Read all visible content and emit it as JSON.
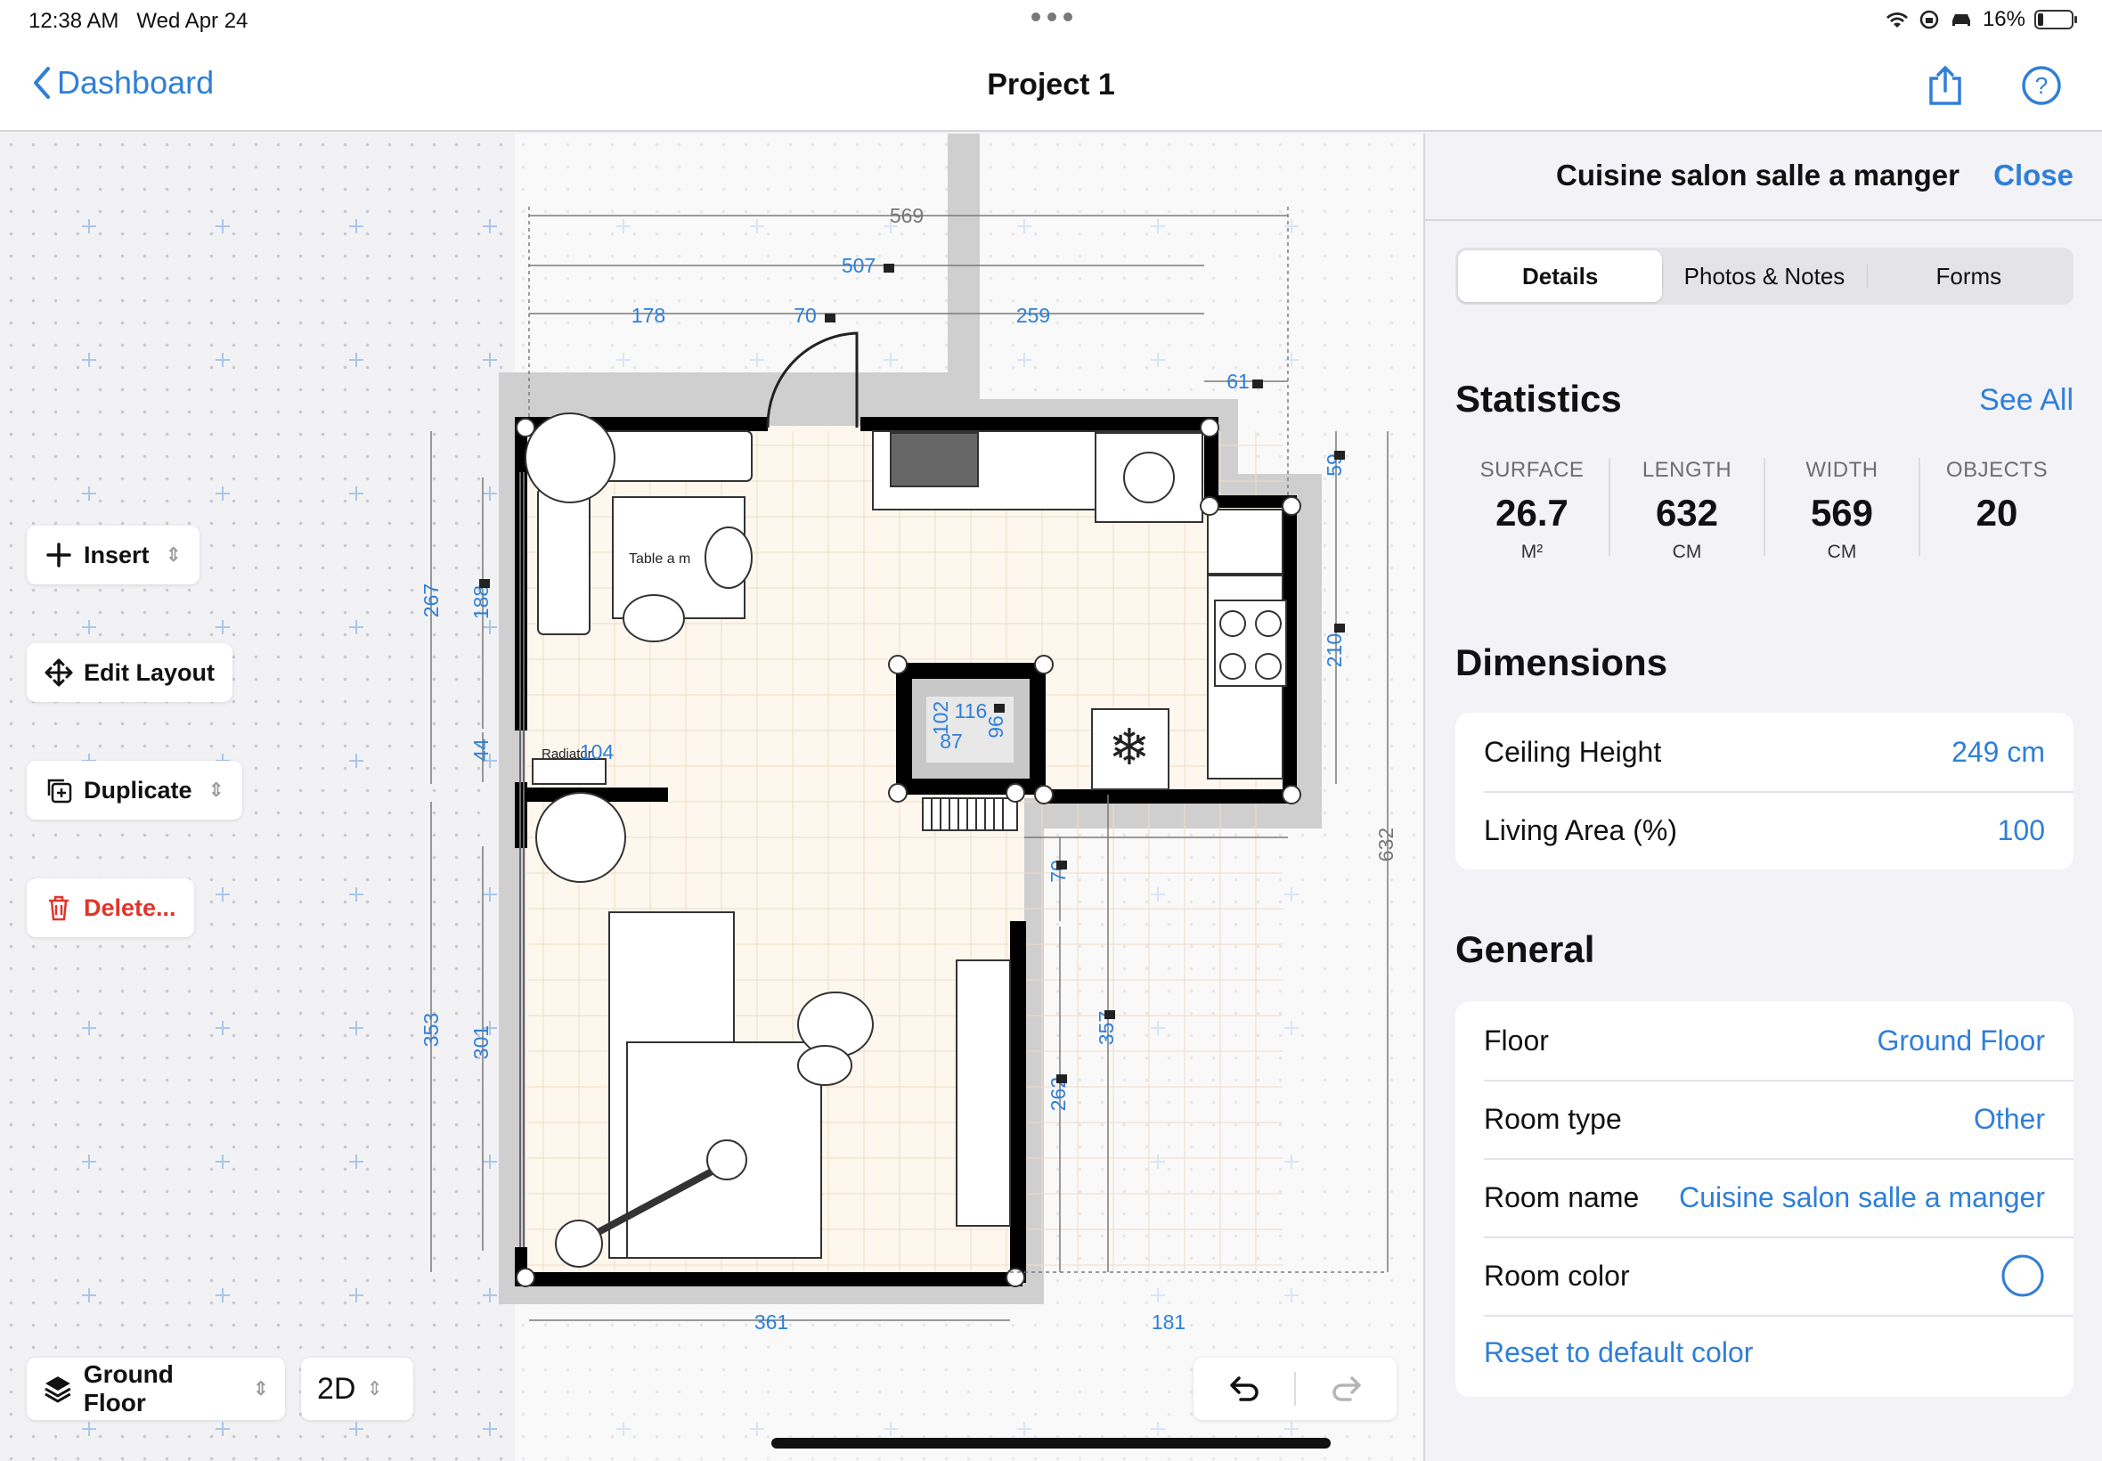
{
  "status_bar": {
    "time": "12:38 AM",
    "date": "Wed Apr 24",
    "battery": "16%",
    "battery_level": 0.16
  },
  "nav": {
    "back_label": "Dashboard",
    "title": "Project 1",
    "share_icon": "share-icon",
    "help_icon": "help-icon"
  },
  "toolbar": {
    "insert_label": "Insert",
    "edit_layout_label": "Edit Layout",
    "duplicate_label": "Duplicate",
    "delete_label": "Delete..."
  },
  "bottom": {
    "floor_label": "Ground Floor",
    "view_mode": "2D"
  },
  "plan": {
    "dims": {
      "top_total": "569",
      "top_inner": "507",
      "seg_left": "178",
      "seg_door": "70",
      "seg_right": "259",
      "step": "61",
      "right_total": "632",
      "right_upper": "59",
      "right_mid": "210",
      "kitchen_bottom": "181",
      "door2": "70",
      "right_lower": "262",
      "right_lower_total": "357",
      "bottom": "361",
      "left_upper_total": "267",
      "left_upper": "188",
      "left_small": "44",
      "left_lower_total": "353",
      "left_lower": "301",
      "radiator_dim": "104",
      "col_w": "116",
      "col_h1": "102",
      "col_h2": "96",
      "col_inner": "87"
    },
    "labels": {
      "table": "Table a m",
      "radiator": "Radiator"
    }
  },
  "panel": {
    "title": "Cuisine salon salle a manger",
    "close_label": "Close",
    "tabs": [
      "Details",
      "Photos & Notes",
      "Forms"
    ],
    "statistics": {
      "title": "Statistics",
      "see_all": "See All",
      "items": [
        {
          "label": "SURFACE",
          "value": "26.7",
          "unit": "M²"
        },
        {
          "label": "LENGTH",
          "value": "632",
          "unit": "CM"
        },
        {
          "label": "WIDTH",
          "value": "569",
          "unit": "CM"
        },
        {
          "label": "OBJECTS",
          "value": "20",
          "unit": ""
        }
      ]
    },
    "dimensions": {
      "title": "Dimensions",
      "rows": [
        {
          "label": "Ceiling Height",
          "value": "249 cm"
        },
        {
          "label": "Living Area (%)",
          "value": "100"
        }
      ]
    },
    "general": {
      "title": "General",
      "rows": [
        {
          "label": "Floor",
          "value": "Ground Floor"
        },
        {
          "label": "Room type",
          "value": "Other"
        },
        {
          "label": "Room name",
          "value": "Cuisine salon salle a manger"
        },
        {
          "label": "Room color",
          "value": ""
        }
      ],
      "reset_label": "Reset to default color"
    }
  },
  "colors": {
    "accent": "#2f7fd8",
    "destructive": "#e0352b",
    "wall": "#000000",
    "dim_text": "#2f7fd8"
  }
}
